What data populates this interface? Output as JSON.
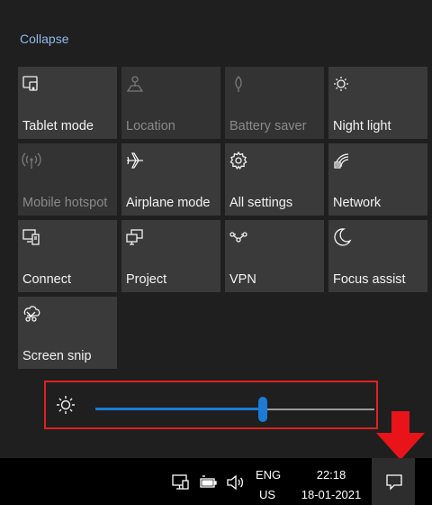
{
  "action_center": {
    "collapse_label": "Collapse",
    "tiles": [
      {
        "label": "Tablet mode",
        "icon": "tablet-mode-icon",
        "enabled": true
      },
      {
        "label": "Location",
        "icon": "location-icon",
        "enabled": false
      },
      {
        "label": "Battery saver",
        "icon": "battery-saver-icon",
        "enabled": false
      },
      {
        "label": "Night light",
        "icon": "night-light-icon",
        "enabled": true
      },
      {
        "label": "Mobile hotspot",
        "icon": "mobile-hotspot-icon",
        "enabled": false
      },
      {
        "label": "Airplane mode",
        "icon": "airplane-icon",
        "enabled": true
      },
      {
        "label": "All settings",
        "icon": "gear-icon",
        "enabled": true
      },
      {
        "label": "Network",
        "icon": "network-icon",
        "enabled": true
      },
      {
        "label": "Connect",
        "icon": "connect-icon",
        "enabled": true
      },
      {
        "label": "Project",
        "icon": "project-icon",
        "enabled": true
      },
      {
        "label": "VPN",
        "icon": "vpn-icon",
        "enabled": true
      },
      {
        "label": "Focus assist",
        "icon": "moon-icon",
        "enabled": true
      },
      {
        "label": "Screen snip",
        "icon": "screen-snip-icon",
        "enabled": true
      }
    ],
    "brightness": {
      "level": 0.6,
      "icon": "brightness-icon"
    }
  },
  "taskbar": {
    "language_line1": "ENG",
    "language_line2": "US",
    "time": "22:18",
    "date": "18-01-2021",
    "tray_icons": [
      "network-icon",
      "battery-icon",
      "volume-icon"
    ],
    "notification_icon": "notification-icon"
  },
  "colors": {
    "accent": "#1b7bd6",
    "highlight_box": "#e02020",
    "annotation_arrow": "#e8141a",
    "tile_bg": "#3a3a3a",
    "panel_bg": "#1f1f1f"
  }
}
